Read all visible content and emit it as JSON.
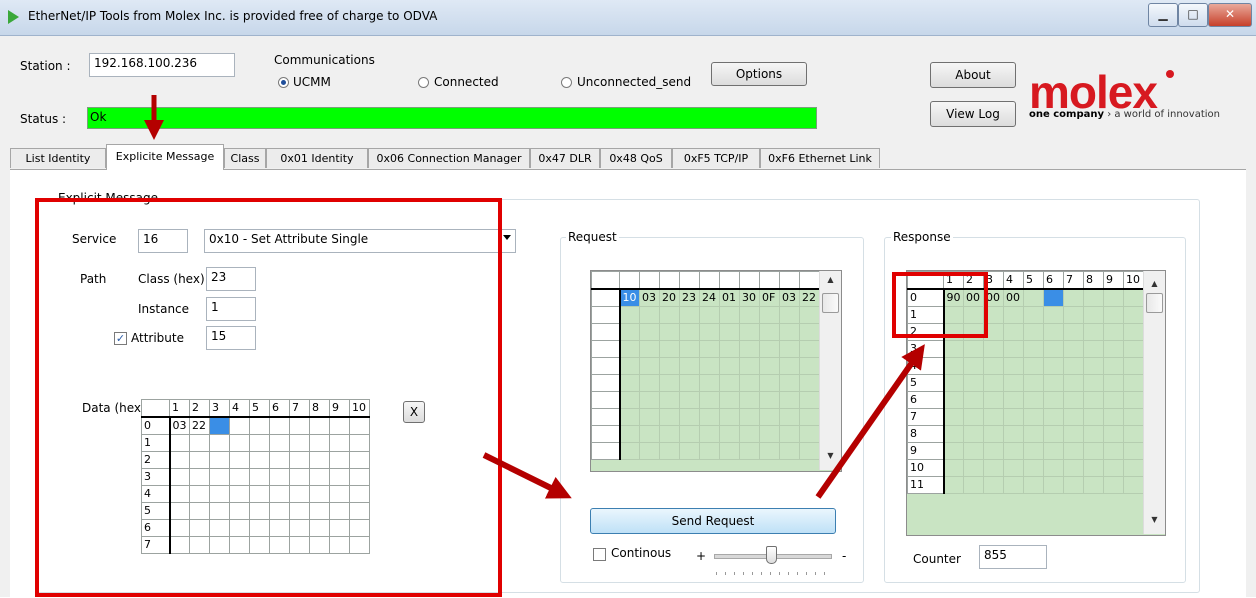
{
  "window": {
    "title": "EtherNet/IP Tools from Molex Inc. is provided free of charge to ODVA",
    "btn_min": "▁",
    "btn_max": "□",
    "btn_close": "✕"
  },
  "station": {
    "label": "Station :",
    "value": "192.168.100.236"
  },
  "communications": {
    "label": "Communications",
    "options": [
      "UCMM",
      "Connected",
      "Unconnected_send"
    ],
    "selected": "UCMM"
  },
  "options_button": "Options",
  "about_button": "About",
  "viewlog_button": "View Log",
  "status": {
    "label": "Status :",
    "value": "Ok"
  },
  "logo": {
    "text": "molex",
    "tagline_bold": "one company",
    "tagline_rest": " › a world of innovation"
  },
  "tabs": [
    "List Identity",
    "Explicite Message",
    "Class",
    "0x01 Identity",
    "0x06 Connection Manager",
    "0x47 DLR",
    "0x48 QoS",
    "0xF5 TCP/IP",
    "0xF6 Ethernet Link"
  ],
  "active_tab": "Explicite Message",
  "explicit": {
    "group_title": "Explicit Message",
    "service_label": "Service",
    "service_code": "16",
    "service_name": "0x10 - Set Attribute Single",
    "path_label": "Path",
    "class_label": "Class (hex)",
    "class_value": "23",
    "instance_label": "Instance",
    "instance_value": "1",
    "attribute_label": "Attribute",
    "attribute_checked": true,
    "attribute_value": "15",
    "data_label": "Data (hex)",
    "clear_button": "X"
  },
  "grid_cols": [
    "1",
    "2",
    "3",
    "4",
    "5",
    "6",
    "7",
    "8",
    "9",
    "10"
  ],
  "data_grid": {
    "rows": [
      "0",
      "1",
      "2",
      "3",
      "4",
      "5",
      "6",
      "7"
    ],
    "row0": [
      "03",
      "22",
      "",
      "",
      "",
      "",
      "",
      "",
      "",
      ""
    ]
  },
  "request": {
    "title": "Request",
    "row0": [
      "10",
      "03",
      "20",
      "23",
      "24",
      "01",
      "30",
      "0F",
      "03",
      "22"
    ],
    "send_button": "Send Request",
    "continous_label": "Continous",
    "slider_plus": "+",
    "slider_minus": "-"
  },
  "response": {
    "title": "Response",
    "rows": [
      "0",
      "1",
      "2",
      "3",
      "4",
      "5",
      "6",
      "7",
      "8",
      "9",
      "10",
      "11"
    ],
    "row0": [
      "90",
      "00",
      "00",
      "00",
      "",
      "",
      "",
      "",
      "",
      ""
    ],
    "counter_label": "Counter",
    "counter_value": "855"
  },
  "colors": {
    "status_ok": "#00ff00",
    "annotation": "#e00000",
    "arrow": "#b40000",
    "grid_green": "#c9e4c3",
    "brand_red": "#d71920"
  }
}
